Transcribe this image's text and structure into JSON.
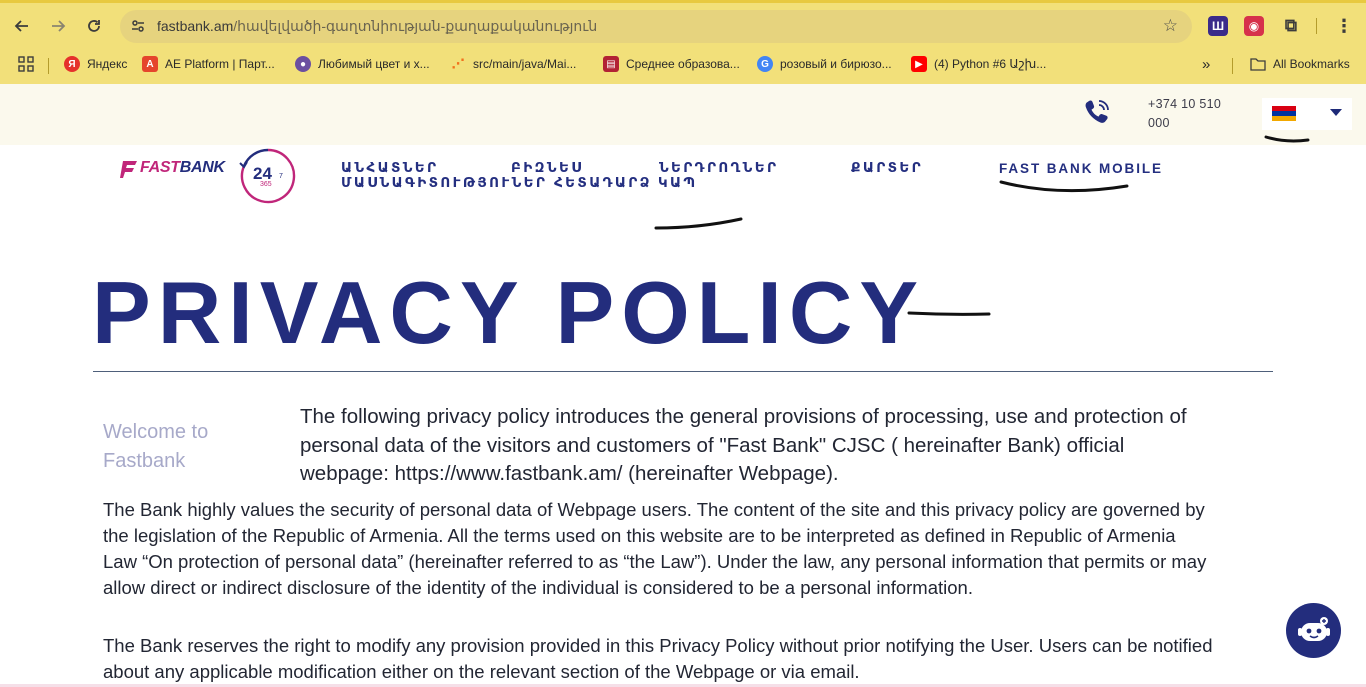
{
  "browser": {
    "url_host": "fastbank.am",
    "url_path": "/հավելվածի-գաղտնիության-քաղաքականություն",
    "bookmarks": [
      {
        "label": "Яндекс"
      },
      {
        "label": "AE Platform | Парт..."
      },
      {
        "label": "Любимый цвет и х..."
      },
      {
        "label": "src/main/java/Mai..."
      },
      {
        "label": "Среднее образова..."
      },
      {
        "label": "розовый и бирюзо..."
      },
      {
        "label": "(4) Python #6 Աշխ..."
      }
    ],
    "all_bookmarks": "All Bookmarks"
  },
  "header": {
    "phone": "+374 10 510 000",
    "language": "hy"
  },
  "logo": {
    "text_prefix": "FAST",
    "text_suffix": "BANK",
    "badge_big": "24",
    "badge_small": "7",
    "badge_sub": "365"
  },
  "menu": {
    "individuals": "ԱՆՀԱՏՆԵՐ",
    "micro": "ՄԱՍՆԱԳԻՏՈՒԹՅՈՒՆԵՐ",
    "business": "ԲԻԶՆԵՍ",
    "investors": "ՆԵՐԴՐՈՂՆԵՐ",
    "feedback": "ՀԵՏԱԴԱՐՁ ԿԱՊ",
    "cards": "ՔԱՐՏԵՐ",
    "mobile": "FAST BANK MOBILE"
  },
  "page": {
    "title": "PRIVACY POLICY",
    "welcome": "Welcome to Fastbank",
    "lead": "The following privacy policy introduces the general provisions of processing, use and protection of personal data of the visitors and customers of \"Fast Bank\" CJSC ( hereinafter Bank) official webpage: https://www.fastbank.am/ (hereinafter Webpage).",
    "para1": "The Bank highly values the security of personal data of Webpage users. The content of the site and this privacy policy are governed by the legislation of the Republic of Armenia. All the terms used on this website are to be interpreted as defined in Republic of Armenia Law “On protection of personal data” (hereinafter referred to as “the Law”). Under the law, any personal information that permits or may allow direct or indirect disclosure of the identity of the individual is considered to be a personal information.",
    "para2": "The Bank reserves the right to modify any provision provided in this Privacy Policy without prior notifying the User. Users can be notified about any applicable modification either on the relevant section of the Webpage or via email."
  },
  "colors": {
    "brand_navy": "#232d7d",
    "brand_pink": "#c0267a",
    "chrome_yellow": "#f2e07a"
  }
}
